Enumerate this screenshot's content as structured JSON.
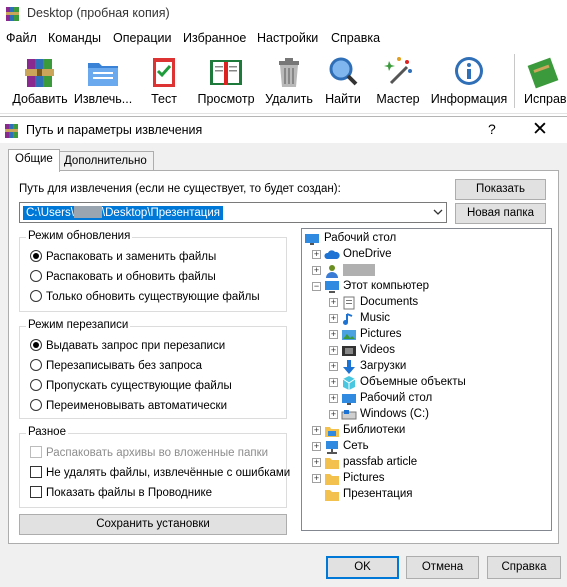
{
  "app": {
    "title": "Desktop (пробная копия)"
  },
  "menu": [
    "Файл",
    "Команды",
    "Операции",
    "Избранное",
    "Настройки",
    "Справка"
  ],
  "toolbar": [
    {
      "label": "Добавить",
      "icon": "archive-books-icon"
    },
    {
      "label": "Извлечь...",
      "icon": "extract-folder-icon"
    },
    {
      "label": "Тест",
      "icon": "test-clipboard-icon"
    },
    {
      "label": "Просмотр",
      "icon": "view-book-icon"
    },
    {
      "label": "Удалить",
      "icon": "trash-icon"
    },
    {
      "label": "Найти",
      "icon": "magnifier-icon"
    },
    {
      "label": "Мастер",
      "icon": "wizard-wand-icon"
    },
    {
      "label": "Информация",
      "icon": "info-icon"
    },
    {
      "label": "Исправи",
      "icon": "repair-icon"
    }
  ],
  "dialog": {
    "title": "Путь и параметры извлечения",
    "help": "?",
    "close": "✕",
    "tabs": [
      "Общие",
      "Дополнительно"
    ],
    "path_label": "Путь для извлечения (если не существует, то будет создан):",
    "path_prefix": "C:\\Users\\",
    "path_suffix": "\\Desktop\\Презентация",
    "show_button": "Показать",
    "new_folder_button": "Новая папка",
    "update_mode": {
      "title": "Режим обновления",
      "options": [
        "Распаковать и заменить файлы",
        "Распаковать и обновить файлы",
        "Только обновить существующие файлы"
      ],
      "selected": 0
    },
    "overwrite_mode": {
      "title": "Режим перезаписи",
      "options": [
        "Выдавать запрос при перезаписи",
        "Перезаписывать без запроса",
        "Пропускать существующие файлы",
        "Переименовывать автоматически"
      ],
      "selected": 0
    },
    "misc": {
      "title": "Разное",
      "options": [
        "Распаковать архивы во вложенные папки",
        "Не удалять файлы, извлечённые с ошибками",
        "Показать файлы в Проводнике"
      ]
    },
    "save_button": "Сохранить установки",
    "tree": [
      "Рабочий стол",
      "OneDrive",
      "",
      "Этот компьютер",
      "Documents",
      "Music",
      "Pictures",
      "Videos",
      "Загрузки",
      "Объемные объекты",
      "Рабочий стол",
      "Windows (C:)",
      "Библиотеки",
      "Сеть",
      "passfab article",
      "Pictures",
      "Презентация"
    ],
    "ok_button": "OK",
    "cancel_button": "Отмена",
    "help_button": "Справка"
  },
  "colors": {
    "selection": "#0078d7",
    "dialog_bg": "#f0f0f0"
  }
}
